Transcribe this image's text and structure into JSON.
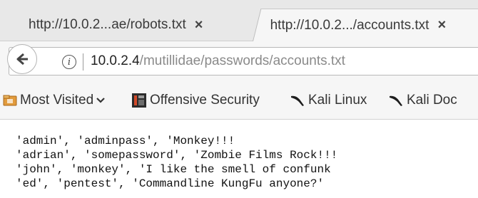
{
  "tabs": [
    {
      "label": "http://10.0.2...ae/robots.txt",
      "active": false
    },
    {
      "label": "http://10.0.2.../accounts.txt",
      "active": true
    }
  ],
  "tab_close_glyph": "×",
  "urlbar": {
    "host": "10.0.2.4",
    "path": "/mutillidae/passwords/accounts.txt"
  },
  "bookmarks": [
    {
      "label": "Most Visited",
      "icon": "folder-icon"
    },
    {
      "label": "Offensive Security",
      "icon": "offsec-icon"
    },
    {
      "label": "Kali Linux",
      "icon": "kali-icon"
    },
    {
      "label": "Kali Doc",
      "icon": "kali-icon"
    }
  ],
  "content": {
    "lines": [
      "'admin', 'adminpass', 'Monkey!!!",
      "'adrian', 'somepassword', 'Zombie Films Rock!!!",
      "'john', 'monkey', 'I like the smell of confunk",
      "'ed', 'pentest', 'Commandline KungFu anyone?'"
    ]
  }
}
